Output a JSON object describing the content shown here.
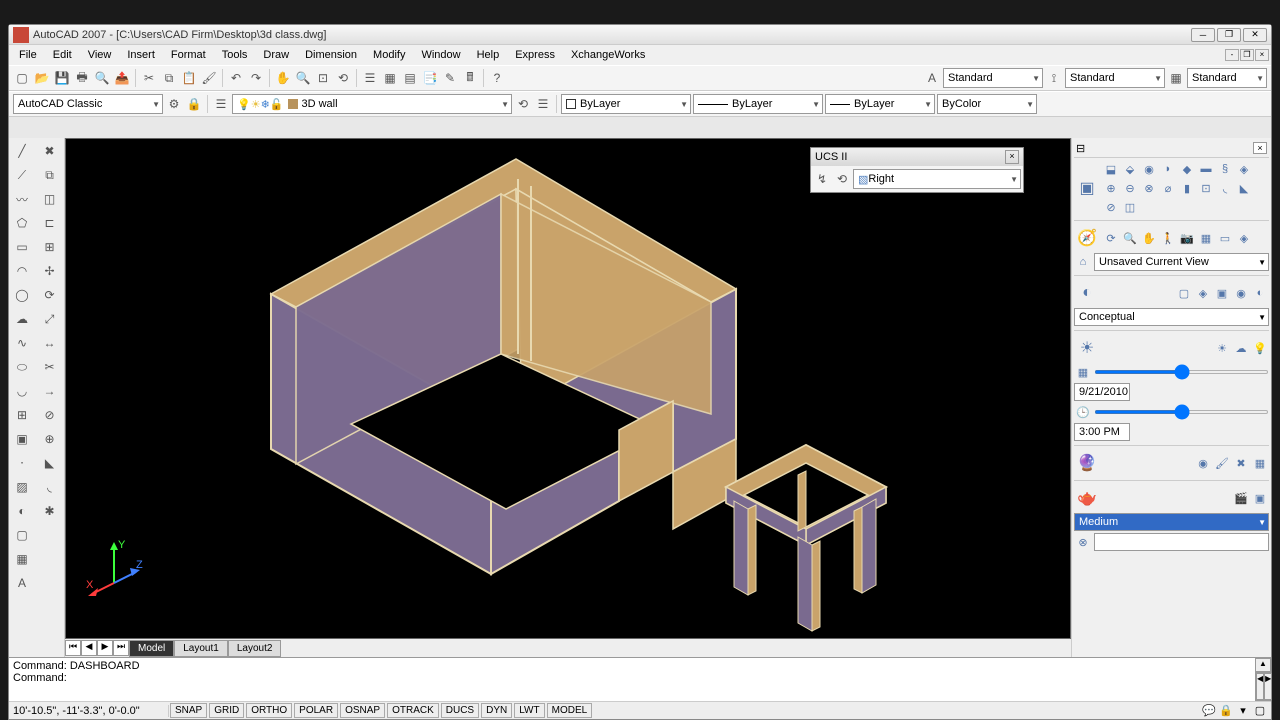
{
  "titlebar": {
    "title": "AutoCAD 2007 - [C:\\Users\\CAD Firm\\Desktop\\3d class.dwg]"
  },
  "menu": [
    "File",
    "Edit",
    "View",
    "Insert",
    "Format",
    "Tools",
    "Draw",
    "Dimension",
    "Modify",
    "Window",
    "Help",
    "Express",
    "XchangeWorks"
  ],
  "toolbar1_combos": {
    "style1": "Standard",
    "style2": "Standard",
    "style3": "Standard"
  },
  "toolbar2": {
    "workspace": "AutoCAD Classic",
    "layer": "3D wall",
    "linetype": "ByLayer",
    "lineweight": "ByLayer",
    "plotstyle": "ByLayer",
    "color": "ByColor"
  },
  "ucs": {
    "title": "UCS II",
    "value": "Right"
  },
  "tabs": [
    "Model",
    "Layout1",
    "Layout2"
  ],
  "right_panel": {
    "view": "Unsaved Current View",
    "visual_style": "Conceptual",
    "date": "9/21/2010",
    "time": "3:00 PM",
    "render": "Medium"
  },
  "cmd": {
    "line1": "Command: DASHBOARD",
    "line2": "Command:"
  },
  "status": {
    "coords": "10'-10.5\", -11'-3.3\", 0'-0.0\"",
    "buttons": [
      "SNAP",
      "GRID",
      "ORTHO",
      "POLAR",
      "OSNAP",
      "OTRACK",
      "DUCS",
      "DYN",
      "LWT",
      "MODEL"
    ]
  },
  "colors": {
    "wall_face": "#7a6a8f",
    "wall_top": "#c9a36a",
    "edge": "#e8d9b0"
  }
}
